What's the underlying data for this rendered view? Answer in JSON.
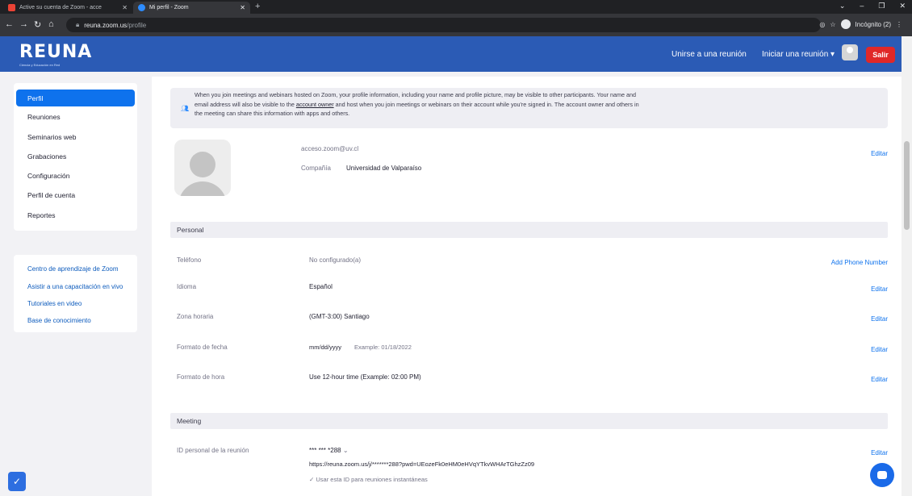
{
  "browser": {
    "tabs": [
      {
        "title": "Active su cuenta de Zoom - acce"
      },
      {
        "title": "Mi perfil - Zoom"
      }
    ],
    "new_tab": "+",
    "url_host": "reuna.zoom.us",
    "url_path": "/profile",
    "incognito_label": "Incógnito (2)"
  },
  "header": {
    "logo": "REUNA",
    "logo_sub": "Ciencia y Educación en Red",
    "join": "Unirse a una reunión",
    "start": "Iniciar una reunión ▾",
    "logout": "Salir"
  },
  "sidebar": {
    "items": [
      {
        "label": "Perfil"
      },
      {
        "label": "Reuniones"
      },
      {
        "label": "Seminarios web"
      },
      {
        "label": "Grabaciones"
      },
      {
        "label": "Configuración"
      },
      {
        "label": "Perfil de cuenta"
      },
      {
        "label": "Reportes"
      }
    ],
    "links": [
      {
        "label": "Centro de aprendizaje de Zoom"
      },
      {
        "label": "Asistir a una capacitación en vivo"
      },
      {
        "label": "Tutoriales en video"
      },
      {
        "label": "Base de conocimiento"
      }
    ]
  },
  "notice": {
    "line1": "When you join meetings and webinars hosted on Zoom, your profile information, including your name and profile picture, may be visible to other participants. Your name and",
    "line2a": "email address will also be visible to the ",
    "link": "account owner",
    "line2b": " and host when you join meetings or webinars on their account while you're signed in. The account owner and others in",
    "line3": "the meeting can share this information with apps and others."
  },
  "profile": {
    "email": "acceso.zoom@uv.cl",
    "company_label": "Compañía",
    "company": "Universidad de Valparaíso",
    "edit": "Editar"
  },
  "personal": {
    "title": "Personal",
    "rows": [
      {
        "label": "Teléfono",
        "value": "No configurado(a)",
        "action": "Add Phone Number"
      },
      {
        "label": "Idioma",
        "value": "Español",
        "action": "Editar"
      },
      {
        "label": "Zona horaria",
        "value": "(GMT-3:00) Santiago",
        "action": "Editar"
      },
      {
        "label": "Formato de fecha",
        "value": "mm/dd/yyyy",
        "extra": "Example: 01/18/2022",
        "action": "Editar"
      },
      {
        "label": "Formato de hora",
        "value": "Use 12-hour time (Example: 02:00 PM)",
        "action": "Editar"
      }
    ]
  },
  "meeting": {
    "title": "Meeting",
    "id_label": "ID personal de la reunión",
    "id_value": "*** *** *288",
    "link": "https://reuna.zoom.us/j/*******288?pwd=UEozeFk0eHM0eHVqYTkvWHArTGhzZz09",
    "checkbox": "Usar esta ID para reuniones instantáneas",
    "action": "Editar"
  }
}
